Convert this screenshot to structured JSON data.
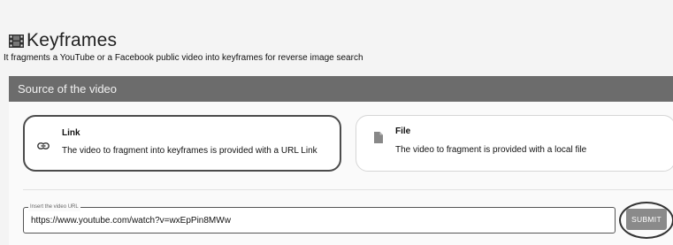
{
  "header": {
    "title": "Keyframes",
    "subtitle": "It fragments a YouTube or a Facebook public video into keyframes for reverse image search",
    "icon": "film-icon"
  },
  "source_panel": {
    "title": "Source of the video",
    "options": [
      {
        "title": "Link",
        "description": "The video to fragment into keyframes is provided with a URL Link",
        "icon": "link-icon",
        "selected": true
      },
      {
        "title": "File",
        "description": "The video to fragment is provided with a local file",
        "icon": "file-icon",
        "selected": false
      }
    ],
    "url_input": {
      "label": "Insert the video URL",
      "value": "https://www.youtube.com/watch?v=wxEpPin8MWw"
    },
    "submit_label": "SUBMIT"
  },
  "colors": {
    "panel_header_bg": "#6c6c6c",
    "submit_bg": "#8a8a8a"
  }
}
